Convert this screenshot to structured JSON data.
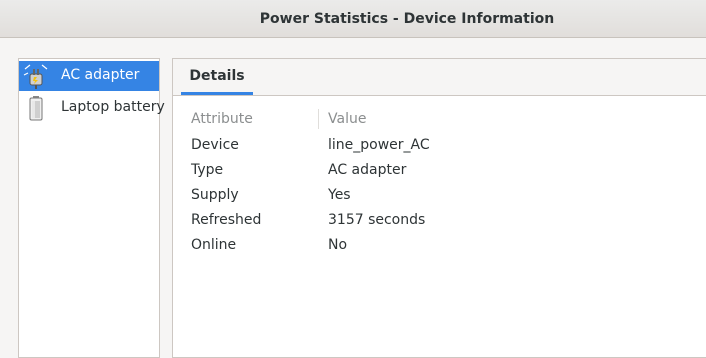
{
  "window": {
    "title": "Power Statistics - Device Information"
  },
  "devices": [
    {
      "label": "AC adapter",
      "icon": "ac-adapter-icon",
      "selected": true
    },
    {
      "label": "Laptop battery",
      "icon": "battery-icon",
      "selected": false
    }
  ],
  "tabs": [
    {
      "label": "Details",
      "active": true
    }
  ],
  "table": {
    "headers": {
      "attribute": "Attribute",
      "value": "Value"
    },
    "rows": [
      {
        "attribute": "Device",
        "value": "line_power_AC"
      },
      {
        "attribute": "Type",
        "value": "AC adapter"
      },
      {
        "attribute": "Supply",
        "value": "Yes"
      },
      {
        "attribute": "Refreshed",
        "value": "3157 seconds"
      },
      {
        "attribute": "Online",
        "value": "No"
      }
    ]
  },
  "colors": {
    "accent": "#3584e4",
    "window_bg": "#f6f5f4",
    "header_text": "#8b8e8f"
  }
}
